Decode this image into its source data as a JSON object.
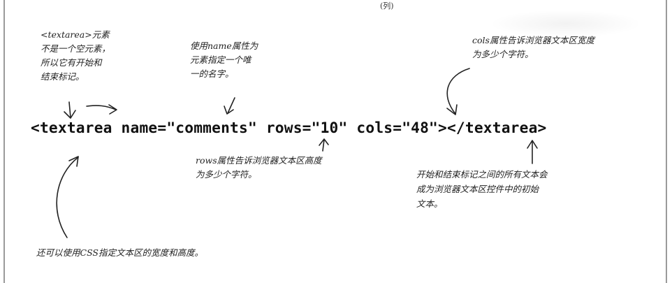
{
  "header": {
    "top_mark": "(列)"
  },
  "code": {
    "line": "<textarea name=\"comments\" rows=\"10\" cols=\"48\"></textarea>"
  },
  "notes": {
    "textarea_not_empty": [
      "<textarea>元素",
      "不是一个空元素，",
      "所以它有开始和",
      "结束标记。"
    ],
    "name_attr": [
      "使用name属性为",
      "元素指定一个唯",
      "一的名字。"
    ],
    "cols_attr": [
      "cols属性告诉浏览器文本区宽度",
      "为多少个字符。"
    ],
    "rows_attr": [
      "rows属性告诉浏览器文本区高度",
      "为多少个字符。"
    ],
    "initial_text": [
      "开始和结束标记之间的所有文本会",
      "成为浏览器文本区控件中的初始",
      "文本。"
    ],
    "css_size": "还可以使用CSS指定文本区的宽度和高度。"
  }
}
